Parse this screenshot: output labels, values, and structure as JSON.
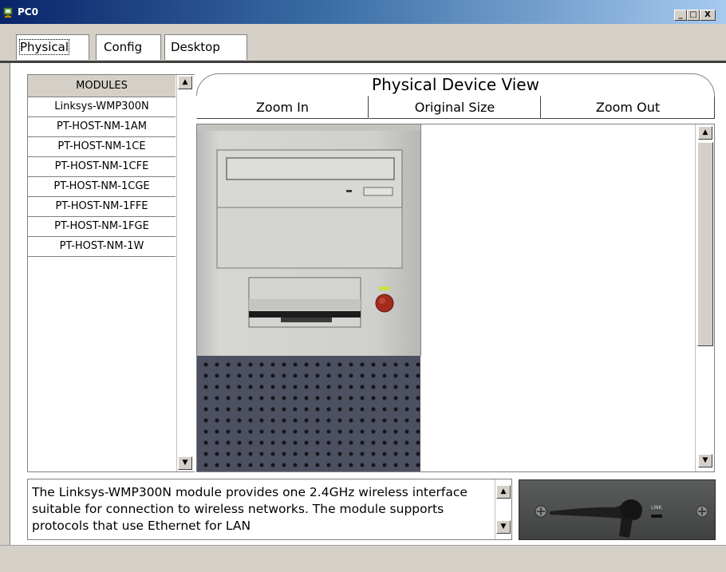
{
  "window": {
    "title": "PC0",
    "controls": {
      "minimize": "_",
      "maximize": "□",
      "close": "X"
    }
  },
  "tabs": [
    {
      "label": "Physical",
      "active": true
    },
    {
      "label": "Config",
      "active": false
    },
    {
      "label": "Desktop",
      "active": false
    }
  ],
  "modules": {
    "header": "MODULES",
    "items": [
      "Linksys-WMP300N",
      "PT-HOST-NM-1AM",
      "PT-HOST-NM-1CE",
      "PT-HOST-NM-1CFE",
      "PT-HOST-NM-1CGE",
      "PT-HOST-NM-1FFE",
      "PT-HOST-NM-1FGE",
      "PT-HOST-NM-1W"
    ]
  },
  "device_view": {
    "title": "Physical Device View",
    "zoom_in": "Zoom In",
    "original_size": "Original Size",
    "zoom_out": "Zoom Out"
  },
  "description": {
    "text": "The Linksys-WMP300N module provides one 2.4GHz wireless interface suitable for connection to wireless networks. The module supports protocols that use Ethernet for LAN"
  },
  "module_image": {
    "link_label": "LINK"
  },
  "colors": {
    "titlebar_start": "#0a246a",
    "titlebar_end": "#a6caf0",
    "window_bg": "#d4d0c8",
    "power_button": "#a52a1c",
    "power_led": "#c8e04a"
  },
  "icons": {
    "title": "pc-icon",
    "scroll_up": "arrow-up-icon",
    "scroll_down": "arrow-down-icon"
  }
}
